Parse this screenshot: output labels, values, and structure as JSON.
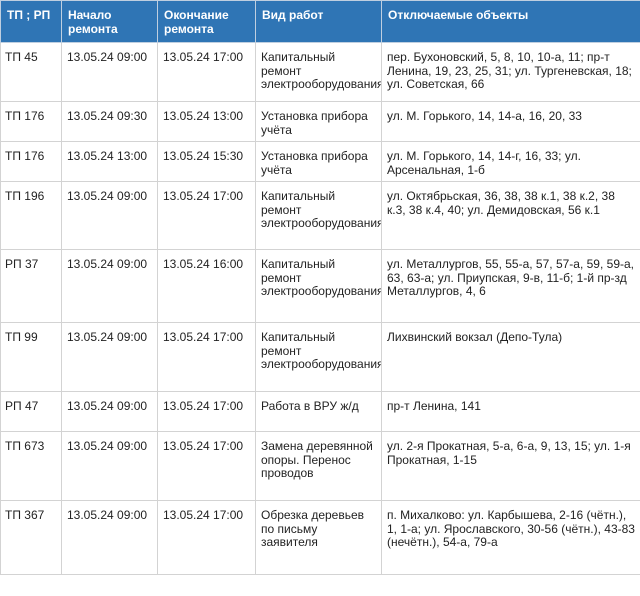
{
  "table": {
    "headers": [
      "ТП ; РП",
      "Начало ремонта",
      "Окончание ремонта",
      "Вид работ",
      "Отключаемые объекты"
    ],
    "rows": [
      [
        "ТП 45",
        "13.05.24 09:00",
        "13.05.24 17:00",
        "Капитальный ремонт электрооборудования",
        "пер. Бухоновский, 5, 8, 10, 10-а, 11; пр-т Ленина, 19, 23, 25, 31; ул. Тургеневская, 18; ул. Советская, 66"
      ],
      [
        "ТП 176",
        "13.05.24 09:30",
        "13.05.24 13:00",
        "Установка прибора учёта",
        "ул. М. Горького, 14, 14-а, 16, 20, 33"
      ],
      [
        "ТП 176",
        "13.05.24 13:00",
        "13.05.24 15:30",
        "Установка прибора учёта",
        "ул. М. Горького, 14, 14-г, 16, 33; ул. Арсенальная, 1-б"
      ],
      [
        "ТП 196",
        "13.05.24 09:00",
        "13.05.24 17:00",
        "Капитальный ремонт электрооборудования",
        "ул. Октябрьская, 36, 38, 38 к.1, 38 к.2, 38 к.3, 38 к.4, 40; ул. Демидовская, 56 к.1"
      ],
      [
        "РП 37",
        "13.05.24 09:00",
        "13.05.24 16:00",
        "Капитальный ремонт электрооборудования",
        "ул. Металлургов, 55, 55-а, 57, 57-а, 59, 59-а, 63, 63-а; ул. Приупская, 9-в, 11-б; 1-й пр-зд Металлургов, 4, 6"
      ],
      [
        "ТП 99",
        "13.05.24 09:00",
        "13.05.24 17:00",
        "Капитальный ремонт электрооборудования",
        "Лихвинский вокзал (Депо-Тула)"
      ],
      [
        "РП 47",
        "13.05.24 09:00",
        "13.05.24 17:00",
        "Работа в ВРУ ж/д",
        "пр-т Ленина, 141"
      ],
      [
        "ТП 673",
        "13.05.24 09:00",
        "13.05.24 17:00",
        "Замена деревянной опоры. Перенос проводов",
        "ул. 2-я Прокатная, 5-а, 6-а, 9, 13, 15; ул. 1-я Прокатная, 1-15"
      ],
      [
        "ТП 367",
        "13.05.24 09:00",
        "13.05.24 17:00",
        "Обрезка деревьев по письму заявителя",
        "п. Михалково: ул. Карбышева, 2-16 (чётн.), 1, 1-а; ул. Ярославского, 30-56 (чётн.), 43-83 (нечётн.), 54-а, 79-а"
      ]
    ]
  }
}
